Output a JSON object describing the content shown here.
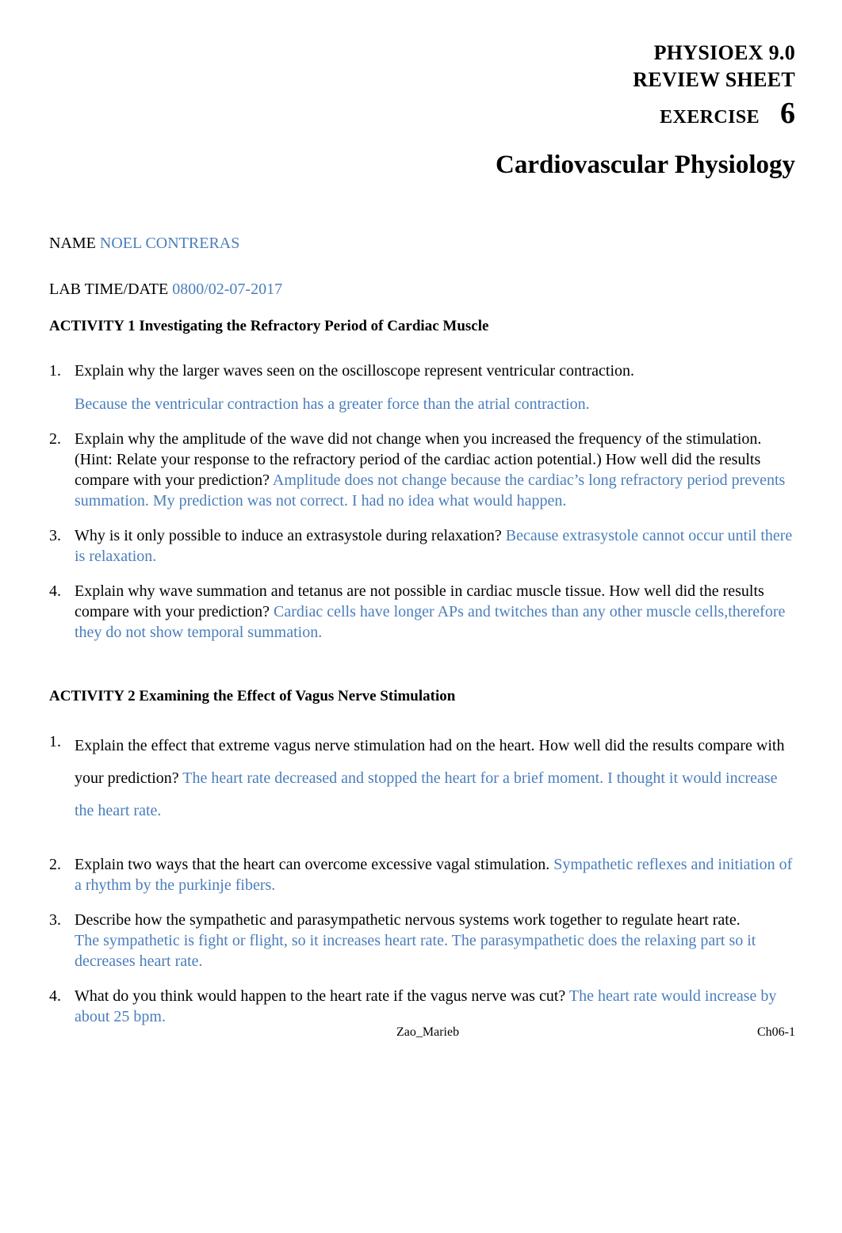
{
  "header": {
    "line1": "PHYSIOEX 9.0",
    "line2": "REVIEW SHEET",
    "exercise_label": "EXERCISE",
    "exercise_number": "6",
    "title": "Cardiovascular Physiology"
  },
  "identity": {
    "name_label": "NAME ",
    "name_value": "NOEL CONTRERAS",
    "date_label": "LAB TIME/DATE ",
    "date_value": "0800/02-07-2017"
  },
  "activity1": {
    "heading": "ACTIVITY 1 Investigating the Refractory Period of Cardiac Muscle",
    "questions": [
      {
        "number": "1.",
        "prompt": "Explain why the larger waves seen on the oscilloscope represent ventricular contraction.",
        "answer": "Because the ventricular contraction has a greater force than the atrial contraction."
      },
      {
        "number": "2.",
        "prompt": "Explain why the amplitude of the wave did not change when you increased the frequency of the stimulation. (Hint: Relate your response to the refractory period of the cardiac action potential.) How well did the results compare with your prediction? ",
        "answer": "Amplitude does not change because the cardiac’s long refractory period prevents summation. My prediction was not correct. I had no idea what would happen."
      },
      {
        "number": "3.",
        "prompt": "Why is it only possible to induce an extrasystole during relaxation? ",
        "answer": "Because extrasystole cannot occur until there is relaxation."
      },
      {
        "number": "4.",
        "prompt": "Explain why wave summation and tetanus are not possible in cardiac muscle tissue. How well did the results compare with your prediction? ",
        "answer": "Cardiac cells have longer APs and twitches than any other muscle cells,therefore they do not show temporal summation."
      }
    ]
  },
  "activity2": {
    "heading": "ACTIVITY 2 Examining the Effect of Vagus Nerve Stimulation",
    "questions": [
      {
        "number": "1.",
        "prompt": "Explain the effect that extreme vagus nerve stimulation had on the heart. How well did the results compare with your prediction? ",
        "answer": "The heart rate decreased and stopped the heart for a brief moment. I thought it would increase the heart rate."
      },
      {
        "number": "2.",
        "prompt": "Explain two ways that the heart can overcome excessive vagal stimulation. ",
        "answer": "Sympathetic reflexes and initiation of a rhythm by the purkinje fibers."
      },
      {
        "number": "3.",
        "prompt": "Describe how the sympathetic and parasympathetic nervous systems work together to regulate heart rate.",
        "answer": "The sympathetic is fight or flight, so it increases heart rate.  The parasympathetic does the relaxing part so it decreases heart rate."
      },
      {
        "number": "4.",
        "prompt": "What do you think would happen to the heart rate if the vagus nerve was cut? ",
        "answer": " The heart rate would increase by about 25 bpm."
      }
    ]
  },
  "footer": {
    "left": "Zao_Marieb",
    "right": "Ch06-1"
  },
  "colors": {
    "ink": "#000000",
    "student_answer": "#4a7ebb",
    "page_background": "#ffffff"
  }
}
